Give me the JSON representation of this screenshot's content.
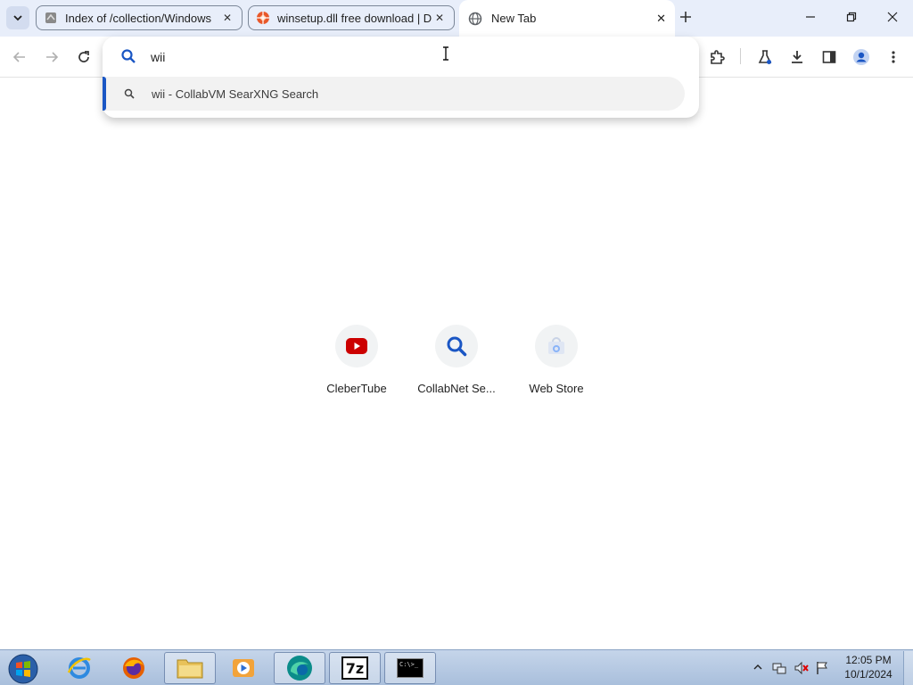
{
  "tabs": [
    {
      "title": "Index of /collection/Windows",
      "favicon": "globe-gray-icon"
    },
    {
      "title": "winsetup.dll free download | D",
      "favicon": "orange-logo-icon"
    },
    {
      "title": "New Tab",
      "favicon": "chrome-globe-icon",
      "active": true
    }
  ],
  "omnibox": {
    "value": "wii",
    "suggestion": "wii - CollabVM SearXNG Search"
  },
  "shortcuts": [
    {
      "label": "CleberTube",
      "icon": "youtube-icon",
      "color": "#cc0000"
    },
    {
      "label": "CollabNet Se...",
      "icon": "search-magnifier-icon",
      "color": "#1a56c4"
    },
    {
      "label": "Web Store",
      "icon": "web-store-icon",
      "color": "#8ab4f8"
    }
  ],
  "taskbar": {
    "apps": [
      "start-orb",
      "internet-explorer",
      "firefox",
      "file-explorer",
      "media-player",
      "browser-active",
      "7zip",
      "command-prompt"
    ],
    "seven_zip_label": "7z",
    "cmd_label": "C:\\>_",
    "time": "12:05 PM",
    "date": "10/1/2024"
  },
  "colors": {
    "tabstrip": "#e8eefa",
    "accent": "#1a56c4",
    "taskbar": "#b7cbe5"
  }
}
